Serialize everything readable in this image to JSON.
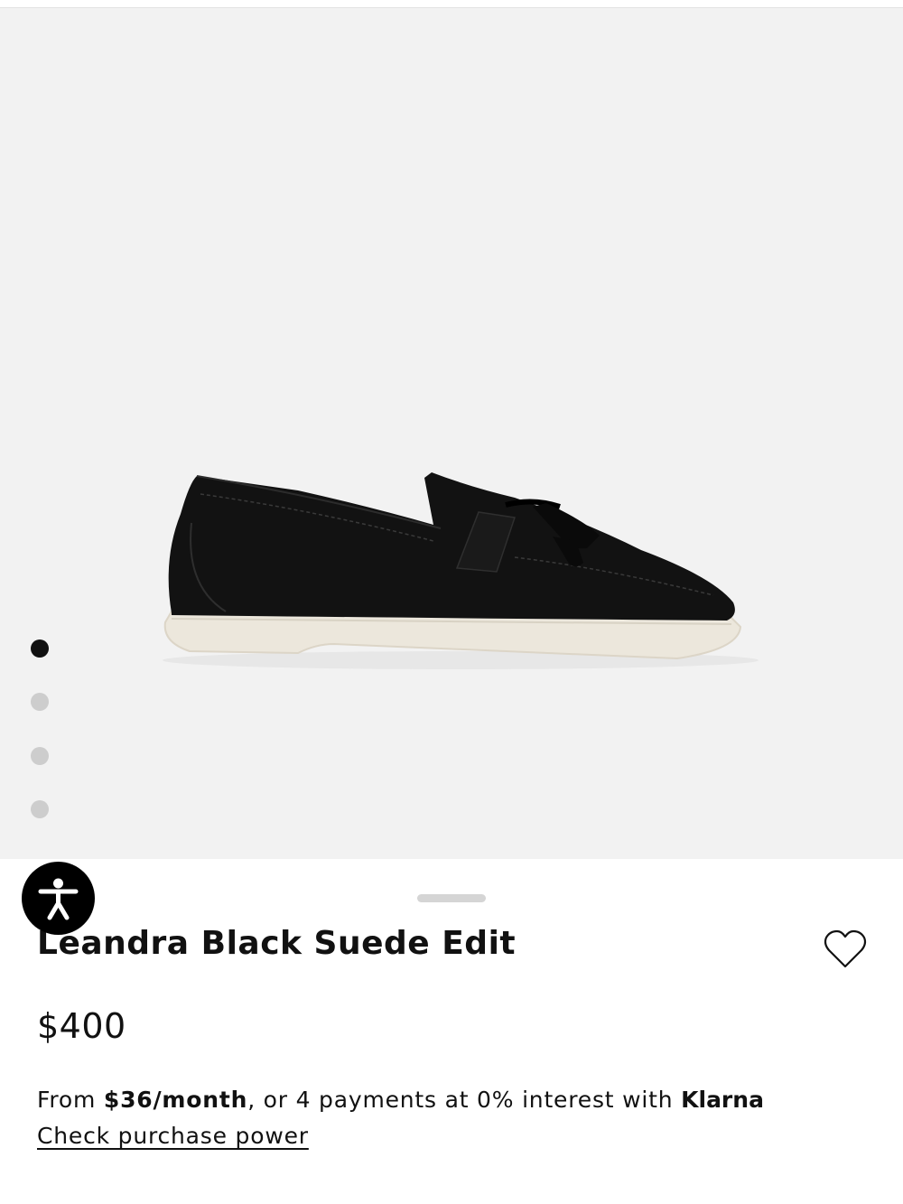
{
  "product": {
    "name": "Leandra Black Suede Edit",
    "price": "$400"
  },
  "gallery": {
    "image_count": 4,
    "active_index": 0
  },
  "financing": {
    "prefix": "From ",
    "monthly_amount": "$36/month",
    "middle": ", or 4 payments at 0% interest with ",
    "provider": "Klarna",
    "link_label": "Check purchase power"
  },
  "icons": {
    "accessibility": "accessibility-icon",
    "wishlist": "heart-outline-icon"
  },
  "colors": {
    "gallery_background": "#f2f2f2",
    "text": "#111111",
    "dot_active": "#111111",
    "dot_inactive": "#cdcdcd",
    "accessibility_button": "#000000"
  }
}
